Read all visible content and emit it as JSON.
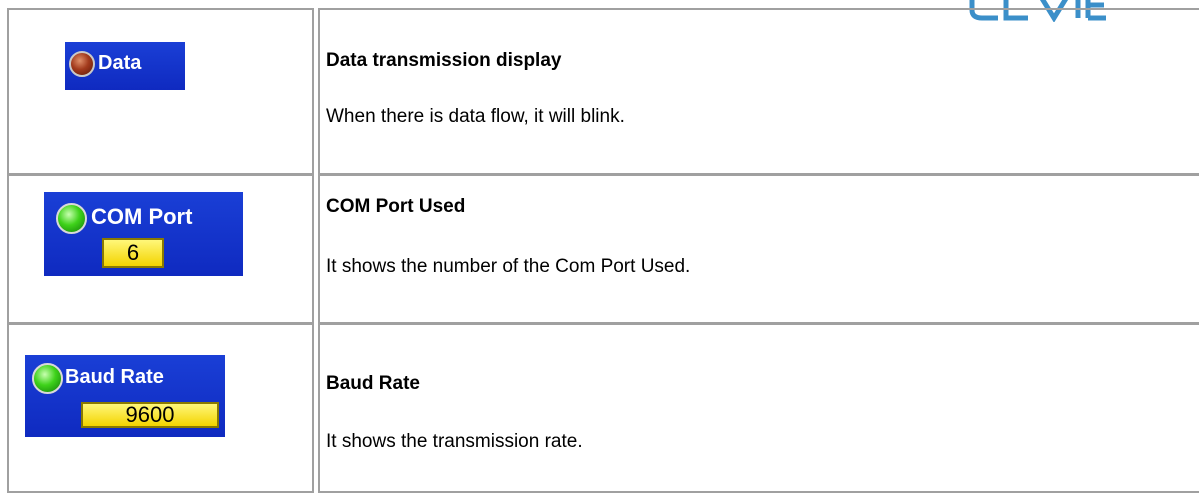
{
  "rows": [
    {
      "widget_label": "Data",
      "title": "Data transmission display",
      "description": "When there is data flow, it will blink."
    },
    {
      "widget_label": "COM Port",
      "widget_value": "6",
      "title": "COM Port Used",
      "description": "It shows the number of the Com Port Used."
    },
    {
      "widget_label": "Baud Rate",
      "widget_value": "9600",
      "title": "Baud Rate",
      "description": "It shows the transmission rate."
    }
  ],
  "colors": {
    "widget_background": "#1a3fd6",
    "led_red": "#a33b1d",
    "led_green": "#3ed21a",
    "value_box": "#f3d400",
    "border": "#a0a0a0"
  },
  "icons": {
    "data_led": "led-red-icon",
    "com_led": "led-green-icon",
    "baud_led": "led-green-icon"
  }
}
